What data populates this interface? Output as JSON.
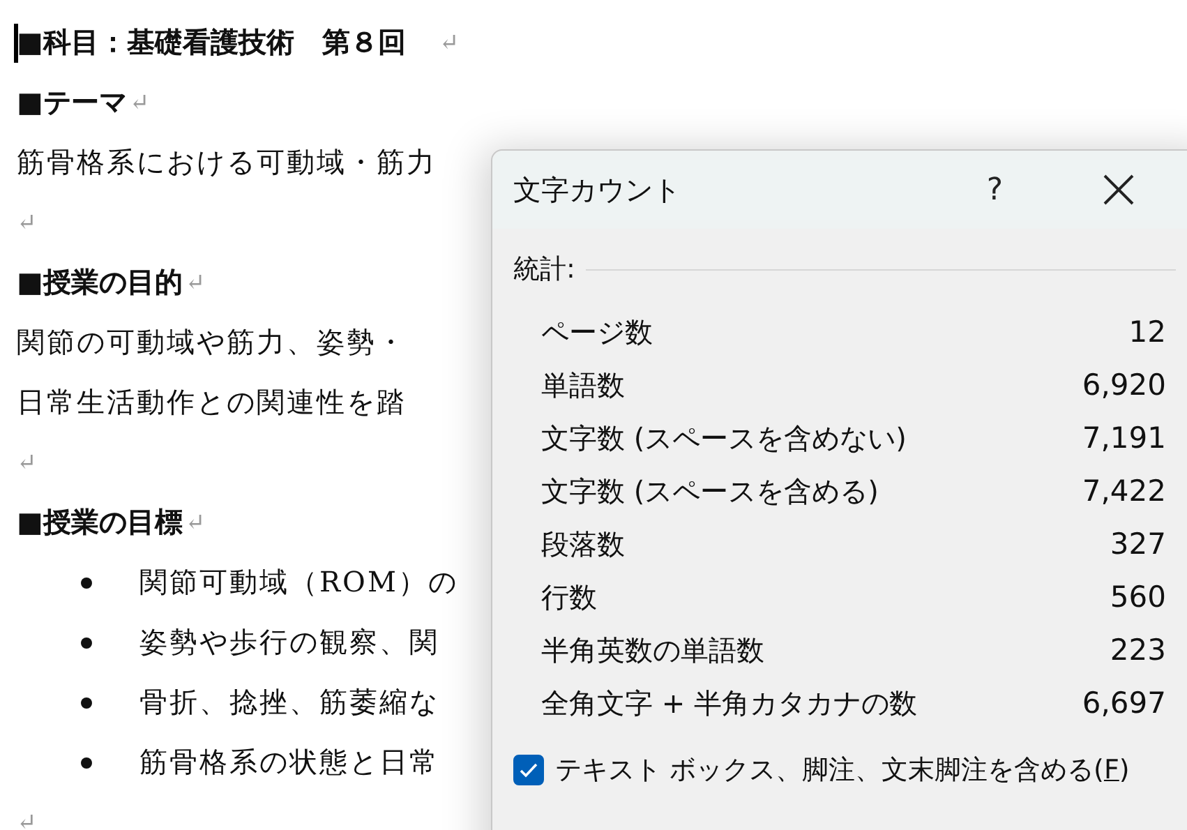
{
  "document": {
    "lines": [
      {
        "kind": "heading",
        "text": "■科目：基礎看護技術　第８回",
        "mark": "↵"
      },
      {
        "kind": "heading",
        "text": "■テーマ",
        "mark": "↵"
      },
      {
        "kind": "body",
        "text": "筋骨格系における可動域・筋力"
      },
      {
        "kind": "empty",
        "mark": "↵"
      },
      {
        "kind": "heading",
        "text": "■授業の目的",
        "mark": "↵"
      },
      {
        "kind": "body",
        "text": "関節の可動域や筋力、姿勢・"
      },
      {
        "kind": "body",
        "text": "日常生活動作との関連性を踏"
      },
      {
        "kind": "empty",
        "mark": "↵"
      },
      {
        "kind": "heading",
        "text": "■授業の目標",
        "mark": "↵"
      },
      {
        "kind": "bullet",
        "text": "関節可動域（ROM）の"
      },
      {
        "kind": "bullet",
        "text": "姿勢や歩行の観察、関"
      },
      {
        "kind": "bullet",
        "text": "骨折、捻挫、筋萎縮な"
      },
      {
        "kind": "bullet",
        "text": "筋骨格系の状態と日常"
      },
      {
        "kind": "empty",
        "mark": "↵"
      }
    ]
  },
  "dialog": {
    "title": "文字カウント",
    "help": "?",
    "section": "統計:",
    "stats": [
      {
        "label": "ページ数",
        "value": "12"
      },
      {
        "label": "単語数",
        "value": "6,920"
      },
      {
        "label": "文字数 (スペースを含めない)",
        "value": "7,191"
      },
      {
        "label": "文字数 (スペースを含める)",
        "value": "7,422"
      },
      {
        "label": "段落数",
        "value": "327"
      },
      {
        "label": "行数",
        "value": "560"
      },
      {
        "label": "半角英数の単語数",
        "value": "223"
      },
      {
        "label": "全角文字 + 半角カタカナの数",
        "value": "6,697"
      }
    ],
    "option": {
      "label": "テキスト ボックス、脚注、文末脚注を含める",
      "mnemonic": "(F)",
      "checked": true
    }
  }
}
